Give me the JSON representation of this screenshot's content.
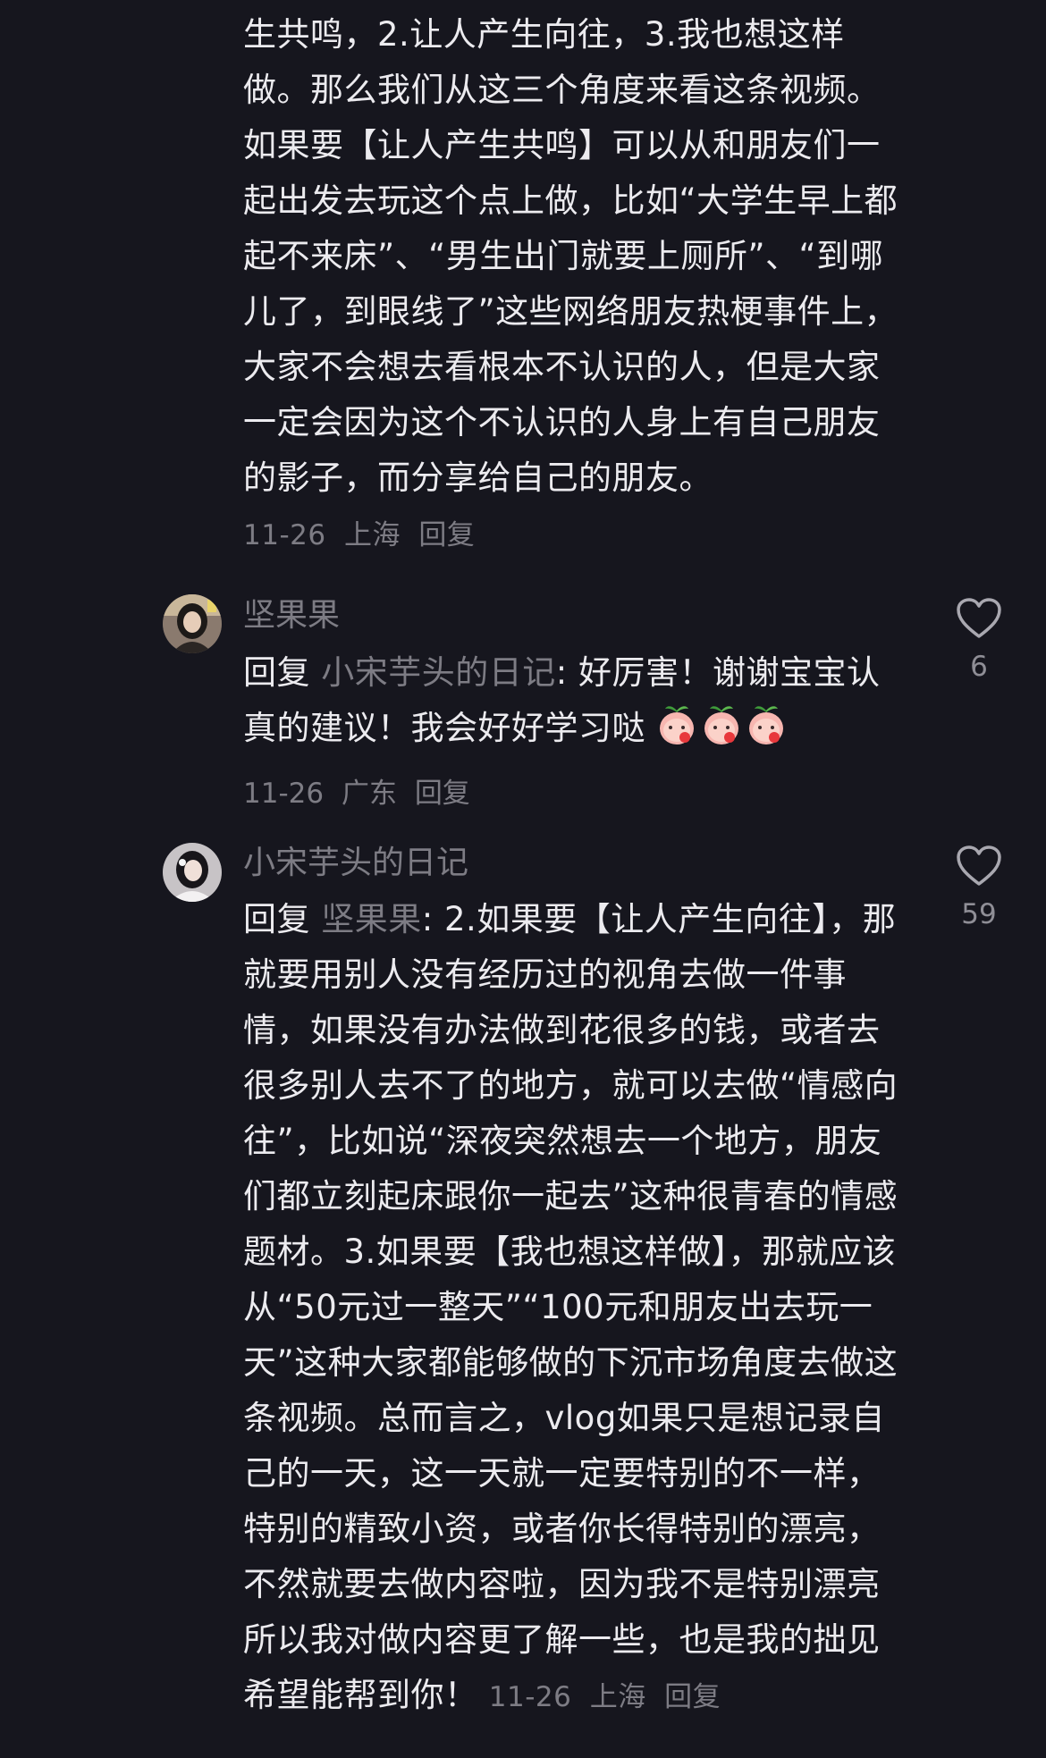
{
  "comment_top": {
    "text": "生共鸣，2.让人产生向往，3.我也想这样做。那么我们从这三个角度来看这条视频。如果要【让人产生共鸣】可以从和朋友们一起出发去玩这个点上做，比如“大学生早上都起不来床”、“男生出门就要上厕所”、“到哪儿了，到眼线了”这些网络朋友热梗事件上，大家不会想去看根本不认识的人，但是大家一定会因为这个不认识的人身上有自己朋友的影子，而分享给自己的朋友。",
    "date": "11-26",
    "location": "上海",
    "reply_label": "回复"
  },
  "comment_2": {
    "username": "坚果果",
    "reply_prefix": "回复",
    "reply_target": "小宋芋头的日记",
    "text": ": 好厉害！谢谢宝宝认真的建议！我会好好学习哒",
    "emojis": [
      "peach-face-icon",
      "peach-face-icon",
      "peach-face-icon"
    ],
    "date": "11-26",
    "location": "广东",
    "reply_label": "回复",
    "like_count": "6",
    "avatar_icon": "user-avatar-icon"
  },
  "comment_3": {
    "username": "小宋芋头的日记",
    "reply_prefix": "回复",
    "reply_target": "坚果果",
    "text": ": 2.如果要【让人产生向往】，那就要用别人没有经历过的视角去做一件事情，如果没有办法做到花很多的钱，或者去很多别人去不了的地方，就可以去做“情感向往”，比如说“深夜突然想去一个地方，朋友们都立刻起床跟你一起去”这种很青春的情感题材。3.如果要【我也想这样做】，那就应该从“50元过一整天”“100元和朋友出去玩一天”这种大家都能够做的下沉市场角度去做这条视频。总而言之，vlog如果只是想记录自己的一天，这一天就一定要特别的不一样，特别的精致小资，或者你长得特别的漂亮，不然就要去做内容啦，因为我不是特别漂亮所以我对做内容更了解一些，也是我的拙见希望能帮到你！",
    "date": "11-26",
    "location": "上海",
    "reply_label": "回复",
    "like_count": "59",
    "avatar_icon": "user-avatar-icon"
  },
  "colors": {
    "background": "#16161e",
    "primary_text": "#ecebef",
    "secondary_text": "#7d7c84"
  }
}
